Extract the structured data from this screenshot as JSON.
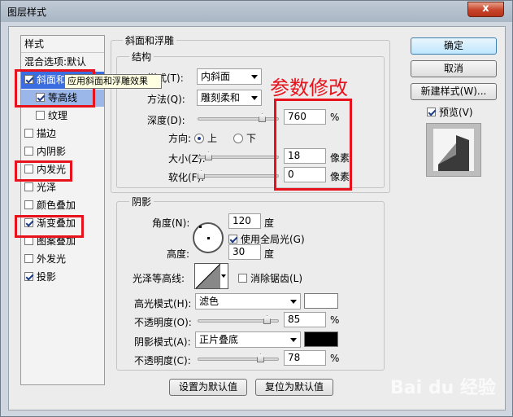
{
  "window": {
    "title": "图层样式",
    "close_glyph": "x"
  },
  "style_list": {
    "header": "样式",
    "items": [
      {
        "label": "混合选项:默认",
        "checkbox": false,
        "checked": false
      },
      {
        "label": "斜面和浮雕",
        "checkbox": true,
        "checked": true
      },
      {
        "label": "等高线",
        "checkbox": true,
        "checked": true
      },
      {
        "label": "纹理",
        "checkbox": true,
        "checked": false
      },
      {
        "label": "描边",
        "checkbox": true,
        "checked": false
      },
      {
        "label": "内阴影",
        "checkbox": true,
        "checked": false
      },
      {
        "label": "内发光",
        "checkbox": true,
        "checked": false
      },
      {
        "label": "光泽",
        "checkbox": true,
        "checked": false
      },
      {
        "label": "颜色叠加",
        "checkbox": true,
        "checked": false
      },
      {
        "label": "渐变叠加",
        "checkbox": true,
        "checked": true
      },
      {
        "label": "图案叠加",
        "checkbox": true,
        "checked": false
      },
      {
        "label": "外发光",
        "checkbox": true,
        "checked": false
      },
      {
        "label": "投影",
        "checkbox": true,
        "checked": true
      }
    ]
  },
  "tooltip": "应用斜面和浮雕效果",
  "bevel": {
    "group_title": "斜面和浮雕",
    "structure_title": "结构",
    "style_label": "样式(T):",
    "style_value": "内斜面",
    "technique_label": "方法(Q):",
    "technique_value": "雕刻柔和",
    "depth_label": "深度(D):",
    "depth_value": "760",
    "depth_unit": "%",
    "direction_label": "方向:",
    "dir_up": "上",
    "dir_down": "下",
    "size_label": "大小(Z):",
    "size_value": "18",
    "size_unit": "像素",
    "soften_label": "软化(F):",
    "soften_value": "0",
    "soften_unit": "像素"
  },
  "shading": {
    "title": "阴影",
    "angle_label": "角度(N):",
    "angle_value": "120",
    "angle_unit": "度",
    "global_light_label": "使用全局光(G)",
    "altitude_label": "高度:",
    "altitude_value": "30",
    "altitude_unit": "度",
    "gloss_label": "光泽等高线:",
    "antialias_label": "消除锯齿(L)",
    "highlight_label": "高光模式(H):",
    "highlight_value": "滤色",
    "highlight_color": "#ffffff",
    "hl_opacity_label": "不透明度(O):",
    "hl_opacity_value": "85",
    "hl_opacity_unit": "%",
    "shadow_label": "阴影模式(A):",
    "shadow_value": "正片叠底",
    "shadow_color": "#000000",
    "sh_opacity_label": "不透明度(C):",
    "sh_opacity_value": "78",
    "sh_opacity_unit": "%"
  },
  "bottom_buttons": {
    "set_default": "设置为默认值",
    "reset_default": "复位为默认值"
  },
  "right_buttons": {
    "ok": "确定",
    "cancel": "取消",
    "new_style": "新建样式(W)...",
    "preview": "预览(V)"
  },
  "annotation": "参数修改",
  "watermark": "Bai du 经验",
  "colors": {
    "accent_red": "#e8121c",
    "selection_blue": "#3a6ee0"
  }
}
